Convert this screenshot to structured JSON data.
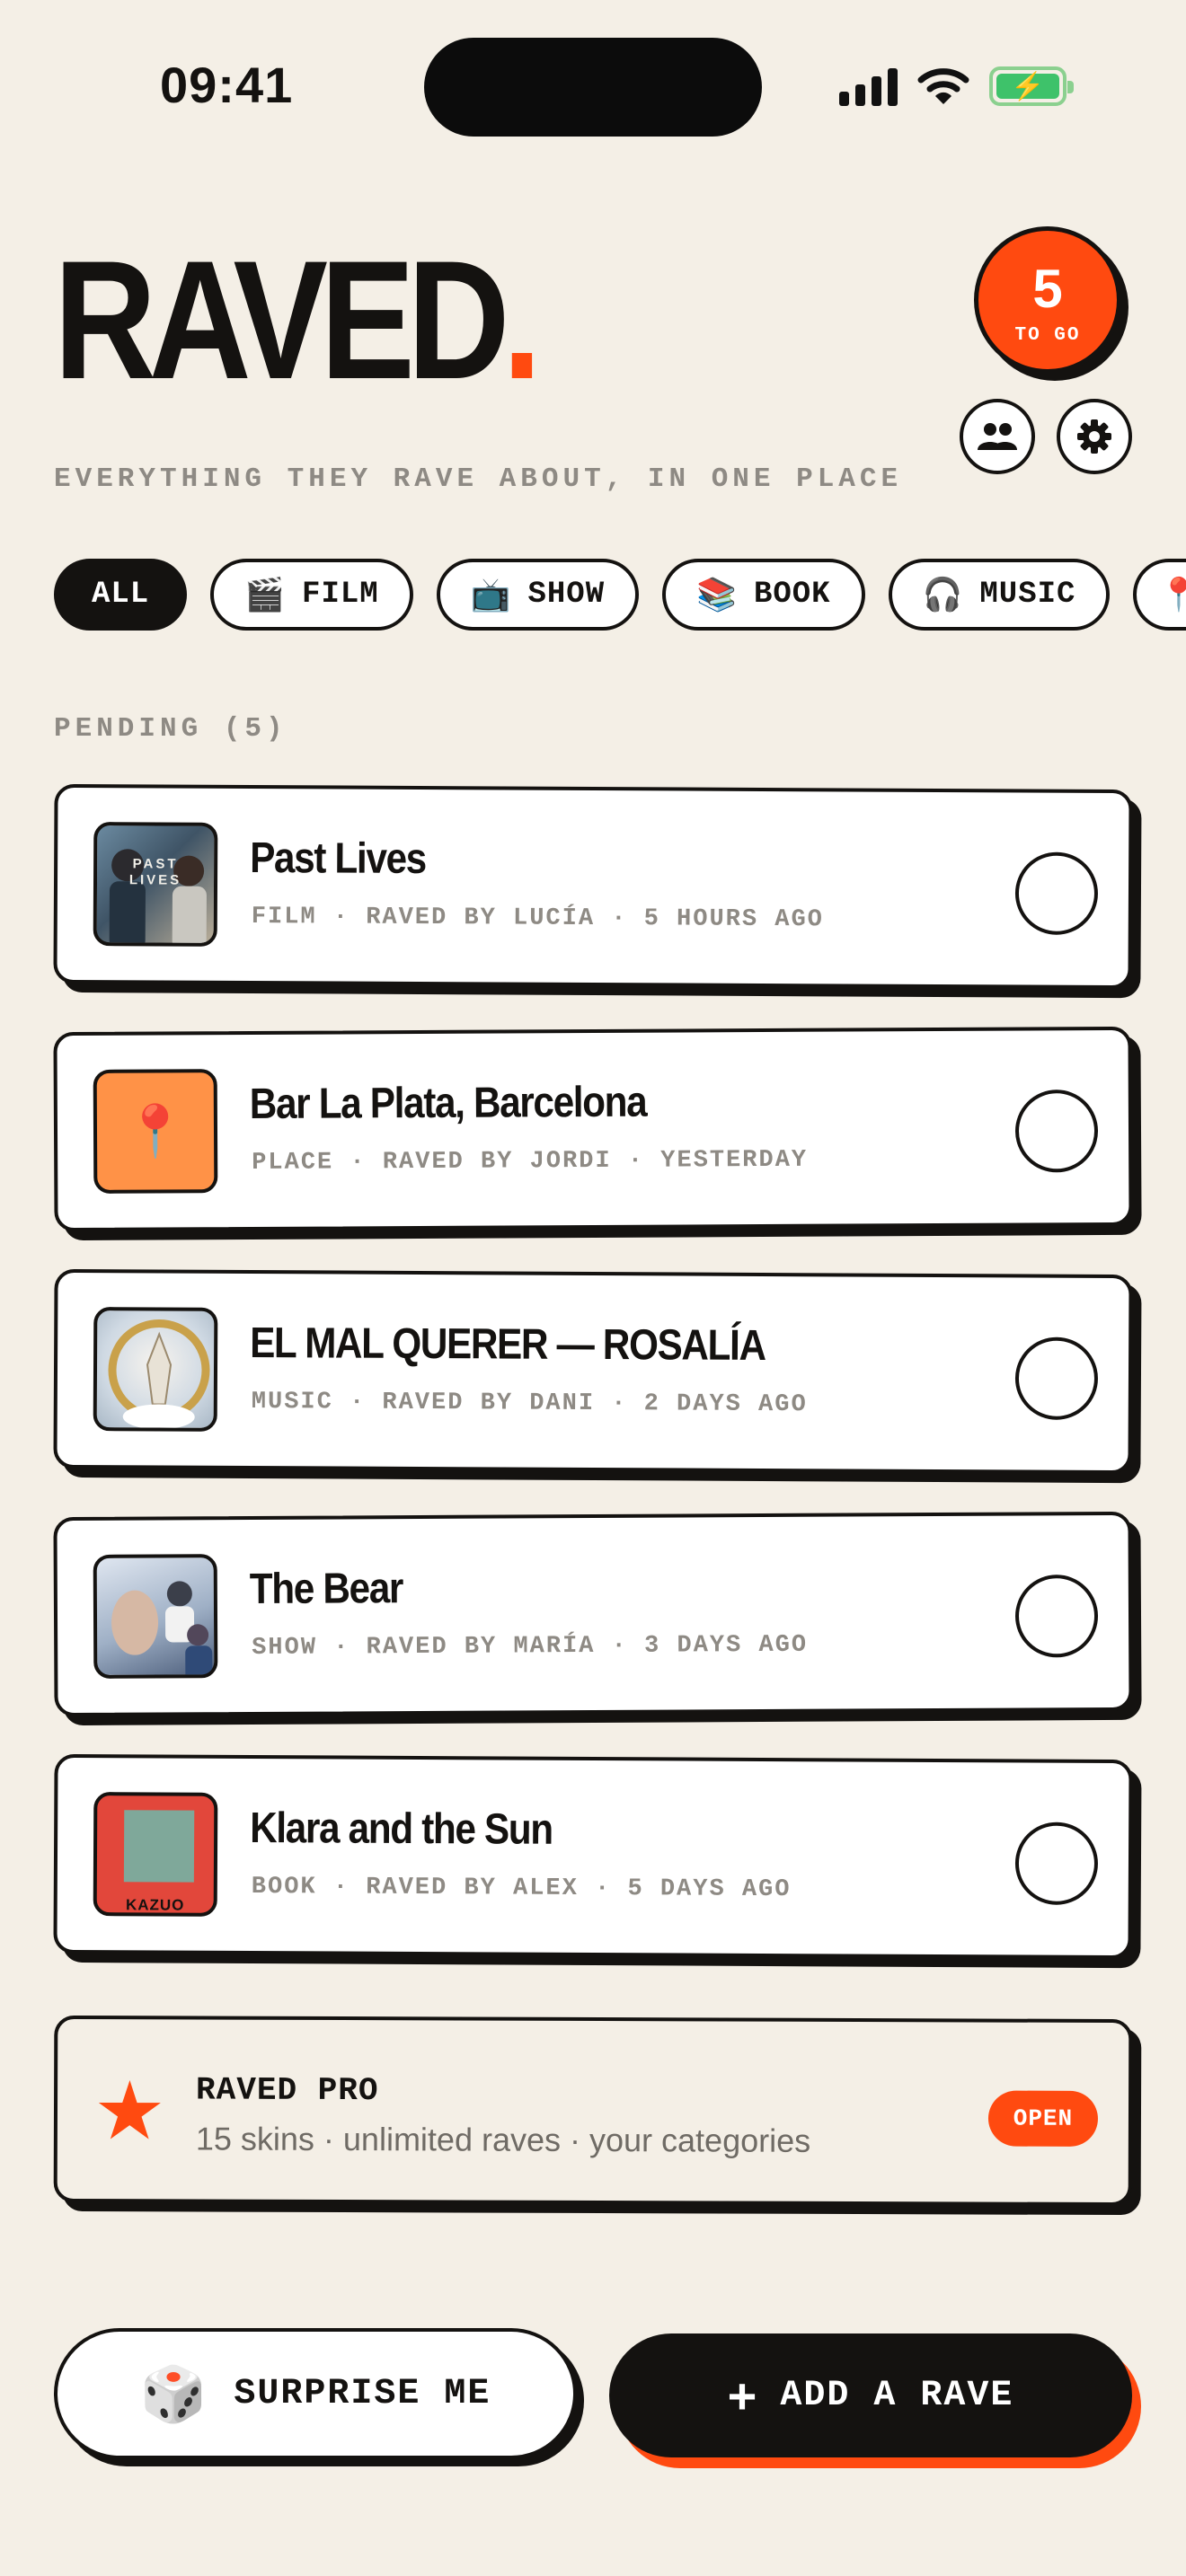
{
  "status": {
    "time": "09:41"
  },
  "header": {
    "brand": "RAVED",
    "brand_dot": ".",
    "tagline": "EVERYTHING THEY RAVE ABOUT, IN ONE PLACE",
    "togo_count": "5",
    "togo_label": "TO GO",
    "friends_icon": "people-icon",
    "settings_icon": "gear-icon"
  },
  "filters": [
    {
      "label": "ALL",
      "icon": "",
      "active": true
    },
    {
      "label": "FILM",
      "icon": "🎬"
    },
    {
      "label": "SHOW",
      "icon": "📺"
    },
    {
      "label": "BOOK",
      "icon": "📚"
    },
    {
      "label": "MUSIC",
      "icon": "🎧"
    },
    {
      "label": "",
      "icon": "📍"
    }
  ],
  "section": {
    "pending_label": "PENDING (5)"
  },
  "raves": [
    {
      "title": "Past Lives",
      "meta": "FILM · RAVED BY LUCÍA · 5 HOURS AGO",
      "thumb_text": "PAST LIVES"
    },
    {
      "title": "Bar La Plata, Barcelona",
      "meta": "PLACE · RAVED BY JORDI · YESTERDAY",
      "thumb_icon": "📍"
    },
    {
      "title": "EL MAL QUERER — ROSALÍA",
      "meta": "MUSIC · RAVED BY DANI · 2 DAYS AGO"
    },
    {
      "title": "The Bear",
      "meta": "SHOW · RAVED BY MARÍA · 3 DAYS AGO"
    },
    {
      "title": "Klara and the Sun",
      "meta": "BOOK · RAVED BY ALEX · 5 DAYS AGO",
      "thumb_text": "KAZUO"
    }
  ],
  "pro": {
    "title": "RAVED PRO",
    "subtitle": "15 skins · unlimited raves · your categories",
    "badge": "OPEN"
  },
  "actions": {
    "surprise_label": "SURPRISE ME",
    "surprise_icon": "🎲",
    "add_label": "ADD A RAVE",
    "add_icon": "+"
  },
  "colors": {
    "accent": "#ff4a10",
    "ink": "#141210",
    "background": "#f4efe6"
  }
}
